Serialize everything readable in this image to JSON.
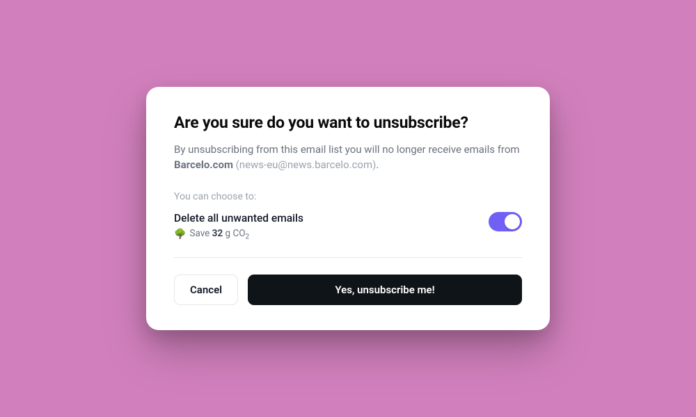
{
  "modal": {
    "title": "Are you sure do you want to unsubscribe?",
    "description_prefix": "By unsubscribing from this email list you will no longer receive emails from ",
    "sender_name": "Barcelo.com",
    "sender_email": " (news-eu@news.barcelo.com)",
    "description_suffix": ".",
    "choose_label": "You can choose to:",
    "option": {
      "title": "Delete all unwanted emails",
      "tree_icon": "🌳",
      "save_prefix": "Save ",
      "save_value": "32",
      "save_unit": " g CO",
      "save_sub": "2",
      "toggle_on": true
    },
    "buttons": {
      "cancel": "Cancel",
      "confirm": "Yes, unsubscribe me!"
    }
  },
  "colors": {
    "background": "#d280bd",
    "accent": "#7260f6",
    "dark": "#0f1419"
  }
}
